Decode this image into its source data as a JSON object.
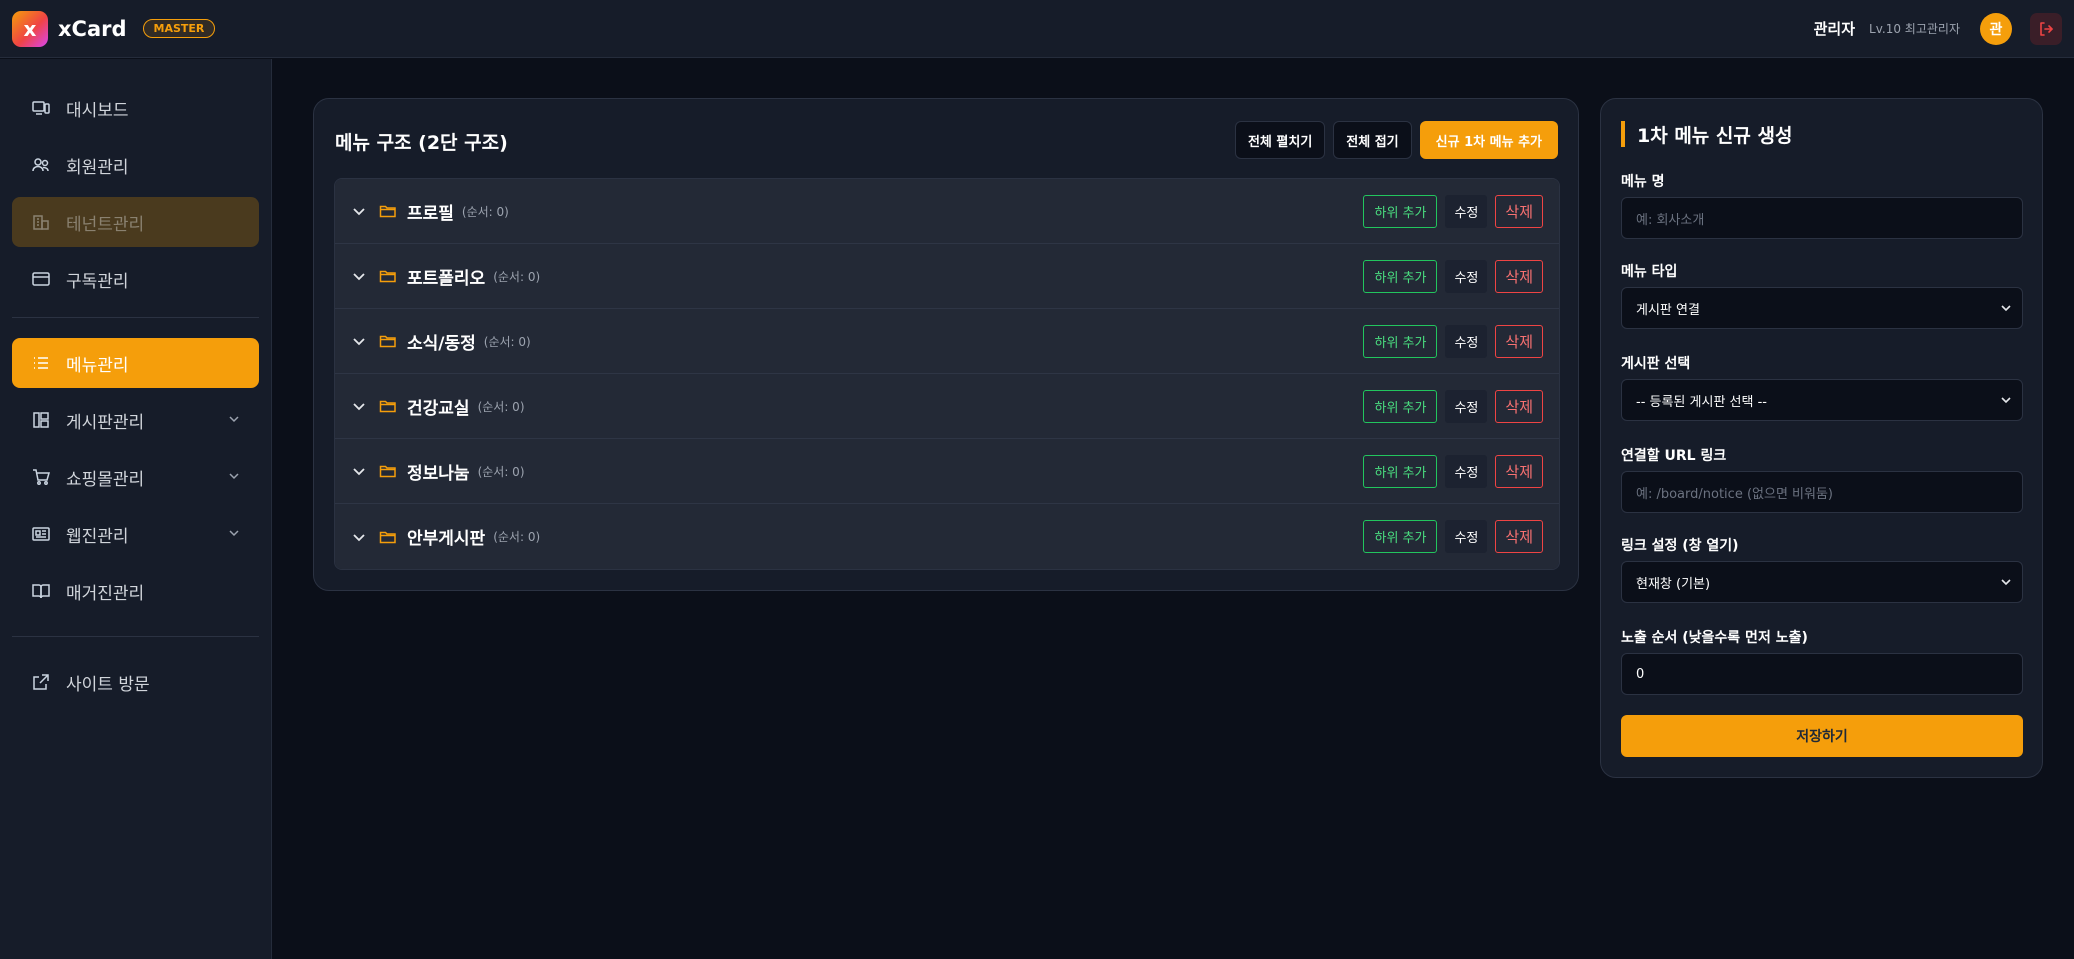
{
  "header": {
    "logo_letter": "x",
    "brand": "xCard",
    "badge": "MASTER",
    "user_name": "관리자",
    "user_level": "Lv.10 최고관리자",
    "avatar_letter": "관"
  },
  "sidebar": {
    "items": [
      {
        "label": "대시보드",
        "icon": "monitor-icon"
      },
      {
        "label": "회원관리",
        "icon": "users-icon"
      },
      {
        "label": "테넌트관리",
        "icon": "building-icon"
      },
      {
        "label": "구독관리",
        "icon": "credit-card-icon"
      },
      {
        "label": "메뉴관리",
        "icon": "list-icon"
      },
      {
        "label": "게시판관리",
        "icon": "board-icon"
      },
      {
        "label": "쇼핑몰관리",
        "icon": "cart-icon"
      },
      {
        "label": "웹진관리",
        "icon": "newspaper-icon"
      },
      {
        "label": "매거진관리",
        "icon": "book-icon"
      },
      {
        "label": "사이트 방문",
        "icon": "external-link-icon"
      }
    ]
  },
  "main": {
    "title": "메뉴 구조 (2단 구조)",
    "expand_all": "전체 펼치기",
    "collapse_all": "전체 접기",
    "add_menu": "신규 1차 메뉴 추가",
    "row_actions": {
      "add_sub": "하위 추가",
      "edit": "수정",
      "delete": "삭제"
    },
    "menus": [
      {
        "name": "프로필",
        "order": "(순서: 0)"
      },
      {
        "name": "포트폴리오",
        "order": "(순서: 0)"
      },
      {
        "name": "소식/동정",
        "order": "(순서: 0)"
      },
      {
        "name": "건강교실",
        "order": "(순서: 0)"
      },
      {
        "name": "정보나눔",
        "order": "(순서: 0)"
      },
      {
        "name": "안부게시판",
        "order": "(순서: 0)"
      }
    ]
  },
  "form": {
    "title": "1차 메뉴 신규 생성",
    "menu_name_label": "메뉴 명",
    "menu_name_placeholder": "예: 회사소개",
    "menu_type_label": "메뉴 타입",
    "menu_type_value": "게시판 연결",
    "board_label": "게시판 선택",
    "board_value": "-- 등록된 게시판 선택 --",
    "url_label": "연결할 URL 링크",
    "url_placeholder": "예: /board/notice (없으면 비워둠)",
    "target_label": "링크 설정 (창 열기)",
    "target_value": "현재창 (기본)",
    "order_label": "노출 순서 (낮을수록 먼저 노출)",
    "order_value": "0",
    "save": "저장하기"
  },
  "colors": {
    "accent": "#f59e0b",
    "green": "#22c55e",
    "red": "#ef4444"
  }
}
